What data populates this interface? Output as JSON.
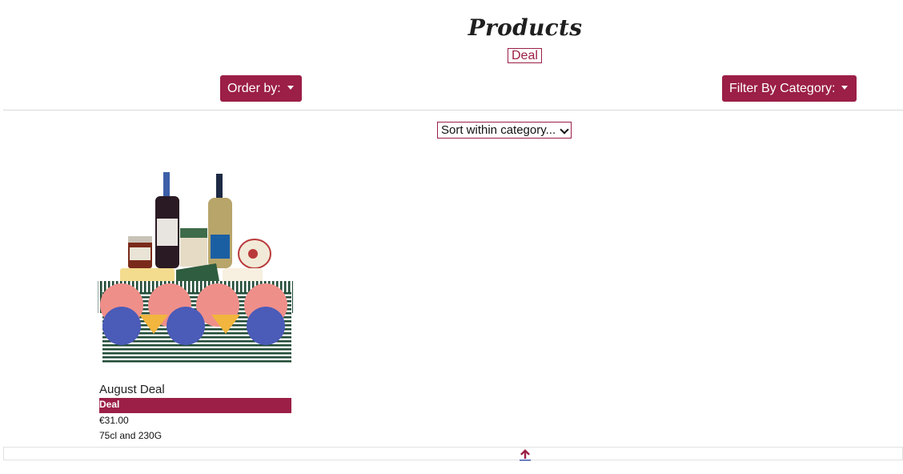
{
  "header": {
    "title": "Products",
    "active_filter": "Deal"
  },
  "toolbar": {
    "order_label": "Order by:",
    "filter_label": "Filter By Category:",
    "sort_selected": "Sort within category..."
  },
  "products": [
    {
      "name": "August Deal",
      "category": "Deal",
      "price": "€31.00",
      "size": "75cl and 230G",
      "image": "gift-hamper-box-with-wine-and-cheese"
    }
  ],
  "icons": {
    "back_to_top": "arrow-up-icon"
  },
  "colors": {
    "accent": "#9b1f46",
    "arrow": "#9b1f46"
  }
}
